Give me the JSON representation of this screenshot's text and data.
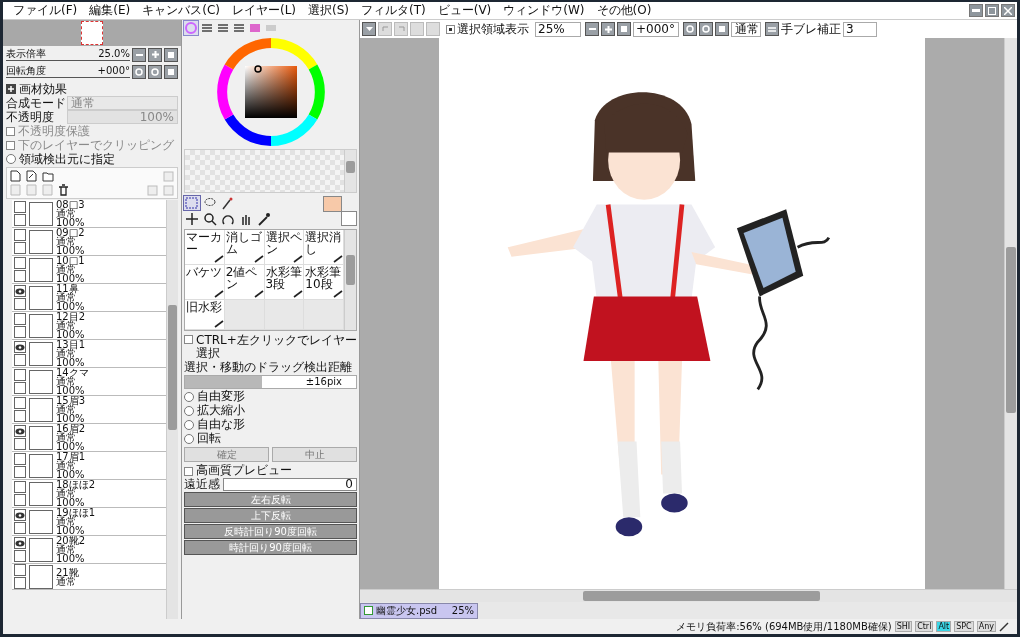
{
  "menu": [
    "ファイル(F)",
    "編集(E)",
    "キャンバス(C)",
    "レイヤー(L)",
    "選択(S)",
    "フィルタ(T)",
    "ビュー(V)",
    "ウィンドウ(W)",
    "その他(O)"
  ],
  "toolbar": {
    "selection_display": {
      "label": "選択領域表示",
      "checked": true
    },
    "zoom": "25%",
    "rotation": "+000°",
    "blend": "通常",
    "stabilizer_label": "手ブレ補正",
    "stabilizer_value": "3"
  },
  "navigator": {
    "zoom_label": "表示倍率",
    "zoom_value": "25.0%",
    "rotation_label": "回転角度",
    "rotation_value": "+000°"
  },
  "layer_props": {
    "texture": "画材効果",
    "blend_label": "合成モード",
    "blend_value": "通常",
    "opacity_label": "不透明度",
    "opacity": {
      "level": 1,
      "reading": "100%"
    },
    "checks": [
      {
        "label": "不透明度保護",
        "checked": false,
        "disabled": true
      },
      {
        "label": "下のレイヤーでクリッピング",
        "checked": false,
        "disabled": true
      }
    ],
    "region_source": {
      "label": "領域検出元に指定",
      "selected": false
    }
  },
  "layers": [
    {
      "name": "08□3",
      "mode": "通常",
      "opacity": "100%",
      "visible": false
    },
    {
      "name": "09□2",
      "mode": "通常",
      "opacity": "100%",
      "visible": false
    },
    {
      "name": "10□1",
      "mode": "通常",
      "opacity": "100%",
      "visible": false
    },
    {
      "name": "11鼻",
      "mode": "通常",
      "opacity": "100%",
      "visible": true
    },
    {
      "name": "12目2",
      "mode": "通常",
      "opacity": "100%",
      "visible": false
    },
    {
      "name": "13目1",
      "mode": "通常",
      "opacity": "100%",
      "visible": true
    },
    {
      "name": "14クマ",
      "mode": "通常",
      "opacity": "100%",
      "visible": false
    },
    {
      "name": "15眉3",
      "mode": "通常",
      "opacity": "100%",
      "visible": false
    },
    {
      "name": "16眉2",
      "mode": "通常",
      "opacity": "100%",
      "visible": true
    },
    {
      "name": "17眉1",
      "mode": "通常",
      "opacity": "100%",
      "visible": false
    },
    {
      "name": "18ほほ2",
      "mode": "通常",
      "opacity": "100%",
      "visible": false
    },
    {
      "name": "19ほほ1",
      "mode": "通常",
      "opacity": "100%",
      "visible": true
    },
    {
      "name": "20靴2",
      "mode": "通常",
      "opacity": "100%",
      "visible": true
    },
    {
      "name": "21靴",
      "mode": "通常",
      "visible": false
    }
  ],
  "brushes": [
    {
      "name": "マーカー"
    },
    {
      "name": "消しゴム"
    },
    {
      "name": "選択ペン"
    },
    {
      "name": "選択消し"
    },
    {
      "name": "バケツ"
    },
    {
      "name": "2値ペン"
    },
    {
      "name": "水彩筆",
      "sub": "3段"
    },
    {
      "name": "水彩筆",
      "sub": "10段"
    },
    {
      "name": "旧水彩"
    }
  ],
  "transform": {
    "ctrl_select": {
      "label": "CTRL+左クリックでレイヤー選択",
      "checked": false
    },
    "drag_label": "選択・移動のドラッグ検出距離",
    "drag": {
      "level": 0.45,
      "reading": "±16pix"
    },
    "modes": [
      {
        "label": "自由変形",
        "selected": false
      },
      {
        "label": "拡大縮小",
        "selected": false
      },
      {
        "label": "自由な形",
        "selected": false
      },
      {
        "label": "回転",
        "selected": false
      }
    ],
    "confirm": {
      "label": "確定",
      "disabled": true
    },
    "cancel": {
      "label": "中止",
      "disabled": true
    },
    "hq_preview": {
      "label": "高画質プレビュー",
      "checked": false
    },
    "perspective_label": "遠近感",
    "perspective_value": "0",
    "actions": [
      "左右反転",
      "上下反転",
      "反時計回り90度回転",
      "時計回り90度回転"
    ]
  },
  "document_tab": {
    "name": "幽霊少女.psd",
    "zoom": "25%"
  },
  "status_bar": {
    "memory": "メモリ負荷率:56% (694MB使用/1180MB確保)",
    "keys": [
      {
        "label": "SHI",
        "pressed": false
      },
      {
        "label": "Ctrl",
        "pressed": false
      },
      {
        "label": "Alt",
        "pressed": true
      },
      {
        "label": "SPC",
        "pressed": false
      },
      {
        "label": "Any",
        "pressed": false
      }
    ]
  }
}
